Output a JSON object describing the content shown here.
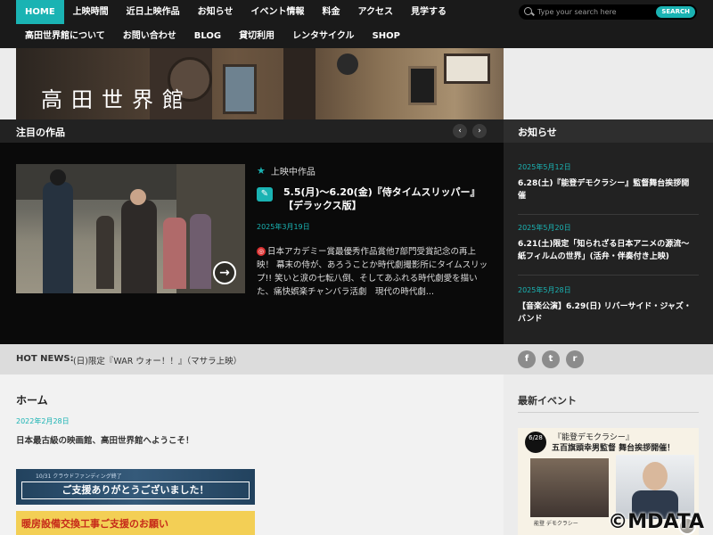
{
  "nav": {
    "row1": [
      "HOME",
      "上映時間",
      "近日上映作品",
      "お知らせ",
      "イベント情報",
      "料金",
      "アクセス",
      "見学する"
    ],
    "row2": [
      "高田世界館について",
      "お問い合わせ",
      "BLOG",
      "貸切利用",
      "レンタサイクル",
      "SHOP"
    ],
    "search_placeholder": "Type your search here",
    "search_button": "SEARCH"
  },
  "banner": {
    "title": "高田世界館"
  },
  "featured": {
    "heading": "注目の作品",
    "prev": "‹",
    "next": "›",
    "category": "上映中作品",
    "title": "5.5(月)～6.20(金)『侍タイムスリッパー』【デラックス版】",
    "date": "2025年3月19日",
    "description": "日本アカデミー賞最優秀作品賞他7部門受賞記念の再上映！ 幕末の侍が、あろうことか時代劇撮影所にタイムスリップ!! 笑いと涙の七転八倒、そしてあふれる時代劇愛を描いた、痛快娯楽チャンバラ活劇　現代の時代劇..."
  },
  "news": {
    "heading": "お知らせ",
    "items": [
      {
        "date": "2025年5月12日",
        "text": "6.28(土)『能登デモクラシー』監督舞台挨拶開催"
      },
      {
        "date": "2025年5月20日",
        "text": "6.21(土)限定「知られざる日本アニメの源流～紙フィルムの世界」(活弁・伴奏付き上映)"
      },
      {
        "date": "2025年5月28日",
        "text": "【音楽公演】6.29(日) リバーサイド・ジャズ・バンド"
      }
    ]
  },
  "hot": {
    "label": "HOT NEWS:",
    "text": "(日)限定『WAR ウォー！！』（マサラ上映）"
  },
  "social": {
    "facebook": "f",
    "twitter": "t",
    "rss": "r"
  },
  "home": {
    "title": "ホーム",
    "date": "2022年2月28日",
    "welcome": "日本最古級の映画館、高田世界館へようこそ！",
    "banner1_small": "10/31 クラウドファンディング終了",
    "banner1_main": "ご支援ありがとうございました！",
    "banner2": "暖房設備交換工事ご支援のお願い"
  },
  "events": {
    "heading": "最新イベント",
    "badge": "6/28",
    "line1": "『能登デモクラシー』",
    "line2": "五百旗頭幸男監督 舞台挨拶開催！",
    "footer": "能登 デモクラシー"
  },
  "watermark": "©MDATA",
  "colors": {
    "accent": "#1ab3b3",
    "nav_bg": "#1a1a1a",
    "featured_bg": "#0a0a0a"
  }
}
